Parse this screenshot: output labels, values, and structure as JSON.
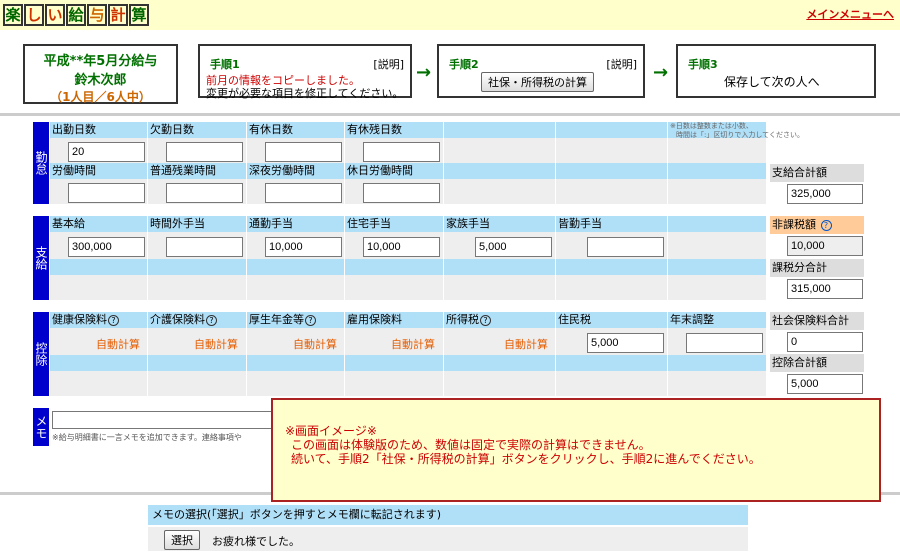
{
  "app": {
    "logo_chars": [
      "楽",
      "し",
      "い",
      "給",
      "与",
      "計",
      "算"
    ],
    "logo_colors": [
      "#006600",
      "#cc3300",
      "#cc3300",
      "#006600",
      "#cc6600",
      "#cc3300",
      "#006600"
    ],
    "main_menu_link": "メインメニューへ"
  },
  "header": {
    "period_label": "平成**年5月分給与",
    "employee_name": "鈴木次郎",
    "progress": "（1人目／6人中）"
  },
  "steps": [
    {
      "title": "手順1",
      "help": "[説明]",
      "line1": "前月の情報をコピーしました。",
      "line2": "変更が必要な項目を修正してください。"
    },
    {
      "title": "手順2",
      "help": "[説明]",
      "button": "社保・所得税の計算"
    },
    {
      "title": "手順3",
      "action": "保存して次の人へ"
    }
  ],
  "arrow": "→",
  "attendance": {
    "section_label": "勤怠",
    "row1_headers": [
      "出勤日数",
      "欠勤日数",
      "有休日数",
      "有休残日数"
    ],
    "row1_values": [
      "20",
      "",
      "",
      ""
    ],
    "row2_headers": [
      "労働時間",
      "普通残業時間",
      "深夜労働時間",
      "休日労働時間"
    ],
    "row2_values": [
      "",
      "",
      "",
      ""
    ],
    "note_line1": "※日数は整数または小数、",
    "note_line2": "時間は「:」区切りで入力してください。"
  },
  "totals_attendance": {
    "label": "支給合計額",
    "value": "325,000"
  },
  "payment": {
    "section_label": "支給",
    "headers": [
      "基本給",
      "時間外手当",
      "通勤手当",
      "住宅手当",
      "家族手当",
      "皆勤手当"
    ],
    "values": [
      "300,000",
      "",
      "10,000",
      "10,000",
      "5,000",
      ""
    ]
  },
  "nontax": {
    "label": "非課税額",
    "value": "10,000"
  },
  "taxable": {
    "label": "課税分合計",
    "value": "315,000"
  },
  "deduction": {
    "section_label": "控除",
    "headers": [
      "健康保険料",
      "介護保険料",
      "厚生年金等",
      "雇用保険料",
      "所得税",
      "住民税",
      "年末調整"
    ],
    "help_flags": [
      true,
      true,
      true,
      false,
      true,
      false,
      false
    ],
    "auto_label": "自動計算",
    "auto_flags": [
      true,
      true,
      true,
      true,
      true,
      false,
      false
    ],
    "values": [
      "",
      "",
      "",
      "",
      "",
      "5,000",
      ""
    ]
  },
  "social_total": {
    "label": "社会保険料合計",
    "value": "0"
  },
  "deduct_total": {
    "label": "控除合計額",
    "value": "5,000"
  },
  "memo": {
    "section_label": "メモ",
    "note": "※給与明細書に一言メモを追加できます。連絡事項や"
  },
  "memo_select": {
    "header": "メモの選択(「選択」ボタンを押すとメモ欄に転記されます)",
    "button": "選択",
    "text": "お疲れ様でした。"
  },
  "popup": {
    "line1": "※画面イメージ※",
    "line2": "この画面は体験版のため、数値は固定で実際の計算はできません。",
    "line3": "続いて、手順2「社保・所得税の計算」ボタンをクリックし、手順2に進んでください。"
  },
  "help_glyph": "?"
}
